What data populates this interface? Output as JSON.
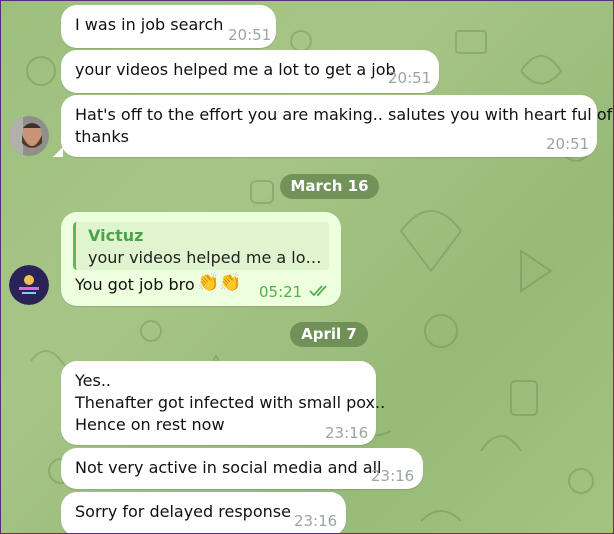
{
  "messages": [
    {
      "text": "I was in job search",
      "time": "20:51"
    },
    {
      "text": "your videos helped me a lot to get a job",
      "time": "20:51"
    },
    {
      "line1": "Hat's off to the effort you are making.. salutes you with heart ful of",
      "line2": "thanks",
      "time": "20:51"
    },
    {
      "reply_name": "Victuz",
      "reply_text": "your videos helped me a lot t...",
      "text": "You got job bro",
      "emoji": "👏👏",
      "time": "05:21"
    },
    {
      "line1": "Yes..",
      "line2": "Thenafter got infected with small pox..",
      "line3": "Hence on rest now",
      "time": "23:16"
    },
    {
      "text": "Not very active in social media and all",
      "time": "23:16"
    },
    {
      "text": "Sorry for delayed response",
      "time": "23:16"
    }
  ],
  "dates": [
    "March 16",
    "April 7"
  ],
  "icons": {
    "read_status": "double-check-icon"
  },
  "colors": {
    "outgoing_bubble": "#eeffde",
    "incoming_bubble": "#ffffff",
    "accent": "#4fae4e",
    "background": "#9dbf7e",
    "frame": "#5e2c7e"
  }
}
